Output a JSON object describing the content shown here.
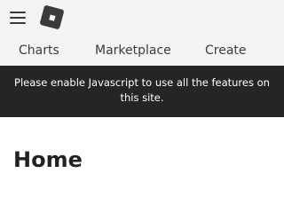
{
  "header": {
    "menu_icon": "hamburger-menu-icon",
    "logo_icon": "roblox-logo-icon",
    "nav": {
      "charts": "Charts",
      "marketplace": "Marketplace",
      "create": "Create"
    }
  },
  "banner": {
    "text": "Please enable Javascript to use all the features on this site."
  },
  "main": {
    "title": "Home"
  },
  "colors": {
    "header_bg": "#f2f4f5",
    "banner_bg": "#232527",
    "text_dark": "#393b3d"
  }
}
